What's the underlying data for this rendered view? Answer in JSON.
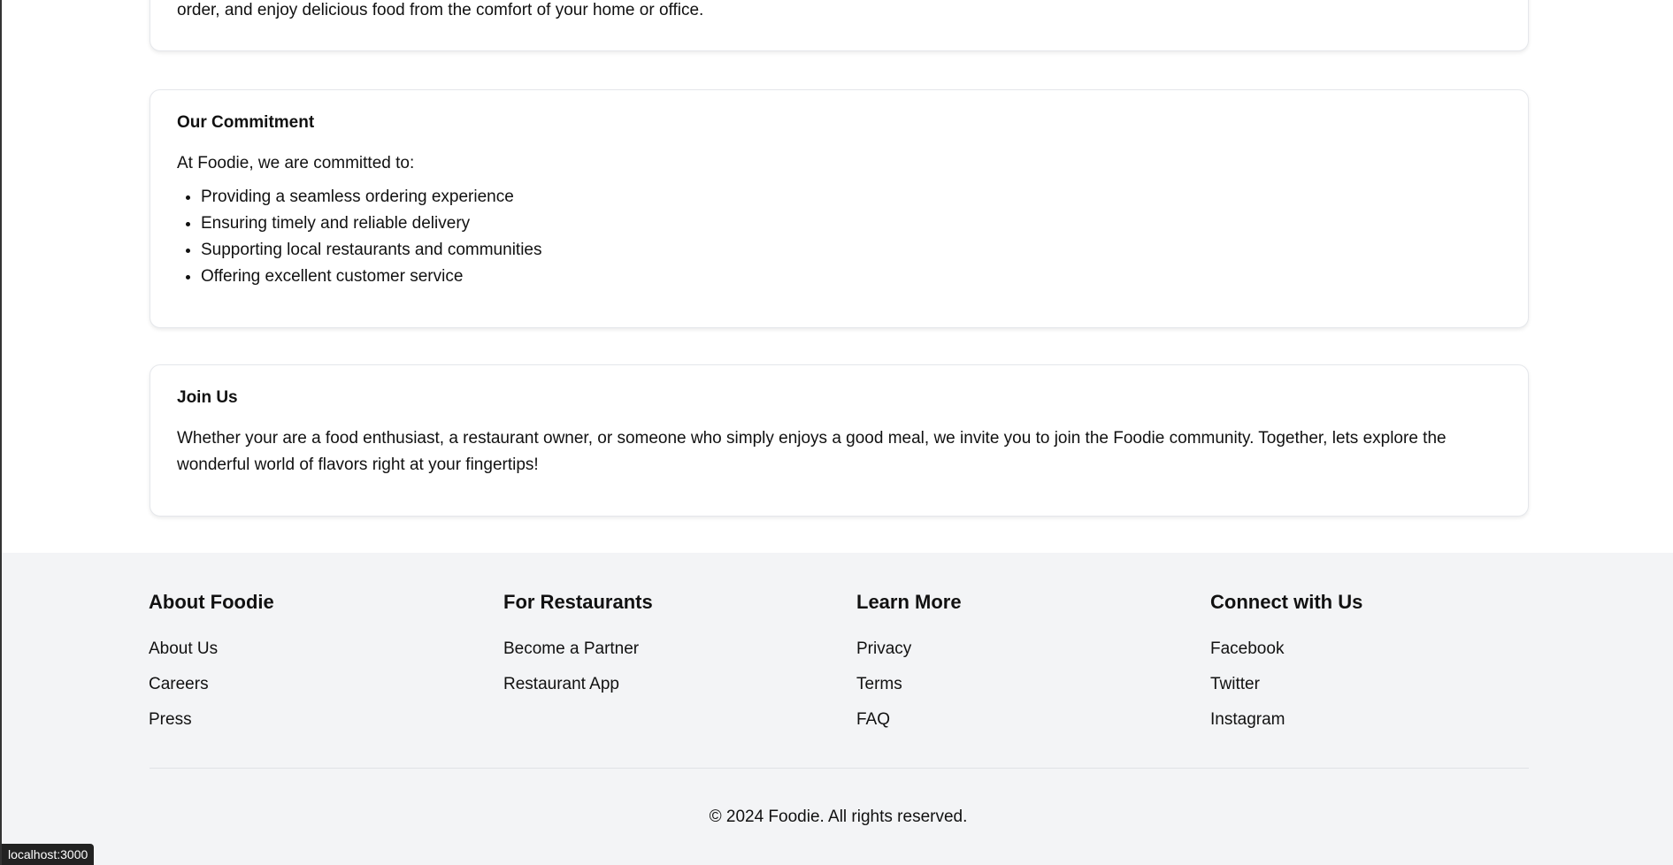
{
  "intro_card": {
    "text_tail": "order, and enjoy delicious food from the comfort of your home or office."
  },
  "commitment": {
    "title": "Our Commitment",
    "intro": "At Foodie, we are committed to:",
    "items": [
      "Providing a seamless ordering experience",
      "Ensuring timely and reliable delivery",
      "Supporting local restaurants and communities",
      "Offering excellent customer service"
    ]
  },
  "join": {
    "title": "Join Us",
    "text": "Whether your are a food enthusiast, a restaurant owner, or someone who simply enjoys a good meal, we invite you to join the Foodie community. Together, lets explore the wonderful world of flavors right at your fingertips!"
  },
  "footer": {
    "columns": [
      {
        "title": "About Foodie",
        "links": [
          "About Us",
          "Careers",
          "Press"
        ]
      },
      {
        "title": "For Restaurants",
        "links": [
          "Become a Partner",
          "Restaurant App"
        ]
      },
      {
        "title": "Learn More",
        "links": [
          "Privacy",
          "Terms",
          "FAQ"
        ]
      },
      {
        "title": "Connect with Us",
        "links": [
          "Facebook",
          "Twitter",
          "Instagram"
        ]
      }
    ],
    "copyright": "© 2024 Foodie. All rights reserved."
  },
  "status_url": "localhost:3000"
}
